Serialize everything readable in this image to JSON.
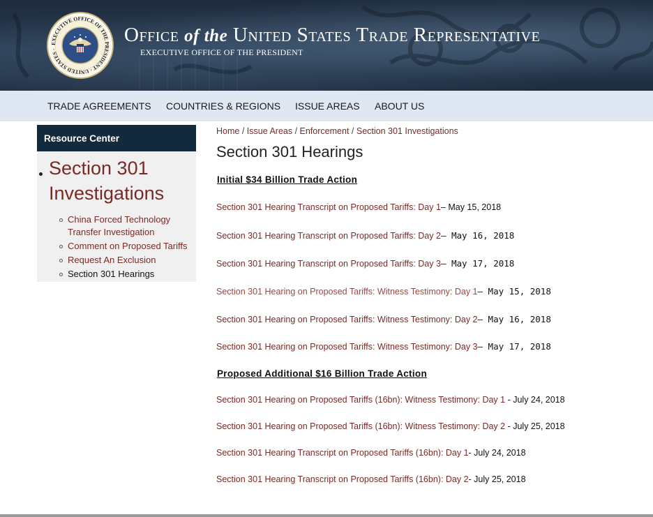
{
  "header": {
    "title_office": "Office",
    "title_of_the": "of the",
    "title_rest": "United States Trade Representative",
    "subtitle": "EXECUTIVE OFFICE OF THE PRESIDENT",
    "seal_text": "EXECUTIVE OFFICE OF THE PRESIDENT · UNITED STATES · TRADE REPRESENTATIVE"
  },
  "nav": {
    "items": [
      "TRADE AGREEMENTS",
      "COUNTRIES & REGIONS",
      "ISSUE AREAS",
      "ABOUT US"
    ]
  },
  "sidebar": {
    "heading": "Resource Center",
    "title": "Section 301 Investigations",
    "items": [
      "China Forced Technology Transfer Investigation",
      "Comment on Proposed Tariffs",
      "Request An Exclusion",
      "Section 301 Hearings"
    ]
  },
  "breadcrumb": {
    "items": [
      "Home",
      "Issue Areas",
      "Enforcement",
      "Section 301 Investigations"
    ],
    "separator": "/"
  },
  "page_title": "Section 301 Hearings",
  "sections": [
    {
      "heading": "Initial $34 Billion Trade Action",
      "entries": [
        {
          "link": "Section 301 Hearing Transcript on Proposed Tariffs: Day 1",
          "date": "– May 15, 2018"
        },
        {
          "link": "Section 301 Hearing Transcript on Proposed Tariffs: Day 2",
          "date": "– May 16, 2018"
        },
        {
          "link": "Section 301 Hearing Transcript on Proposed Tariffs: Day 3",
          "date": "– May 17, 2018"
        },
        {
          "link": "Section 301 Hearing on Proposed Tariffs: Witness Testimony: Day 1",
          "date": "– May 15, 2018"
        },
        {
          "link": "Section 301 Hearing on Proposed Tariffs: Witness Testimony: Day 2",
          "date": "– May 16, 2018"
        },
        {
          "link": "Section 301 Hearing on Proposed Tariffs: Witness Testimony: Day 3",
          "date": "– May 17, 2018"
        }
      ]
    },
    {
      "heading": "Proposed Additional $16 Billion Trade Action",
      "entries": [
        {
          "link": "Section 301 Hearing on Proposed Tariffs (16bn): Witness Testimony: Day 1",
          "date": " - July 24, 2018"
        },
        {
          "link": "Section 301 Hearing on Proposed Tariffs (16bn): Witness Testimony: Day 2",
          "date": " - July 25, 2018"
        },
        {
          "link": "Section 301 Hearing Transcript on Proposed Tariffs (16bn): Day 1",
          "date": "- July 24, 2018"
        },
        {
          "link": "Section 301 Hearing Transcript on Proposed Tariffs (16bn): Day 2",
          "date": "- July 25, 2018"
        }
      ]
    }
  ],
  "colors": {
    "link": "#7a2a26",
    "nav_bg": "#dfe7f2",
    "sidebar_head_bg": "#132a3d",
    "header_bg": "#1e2d40"
  }
}
